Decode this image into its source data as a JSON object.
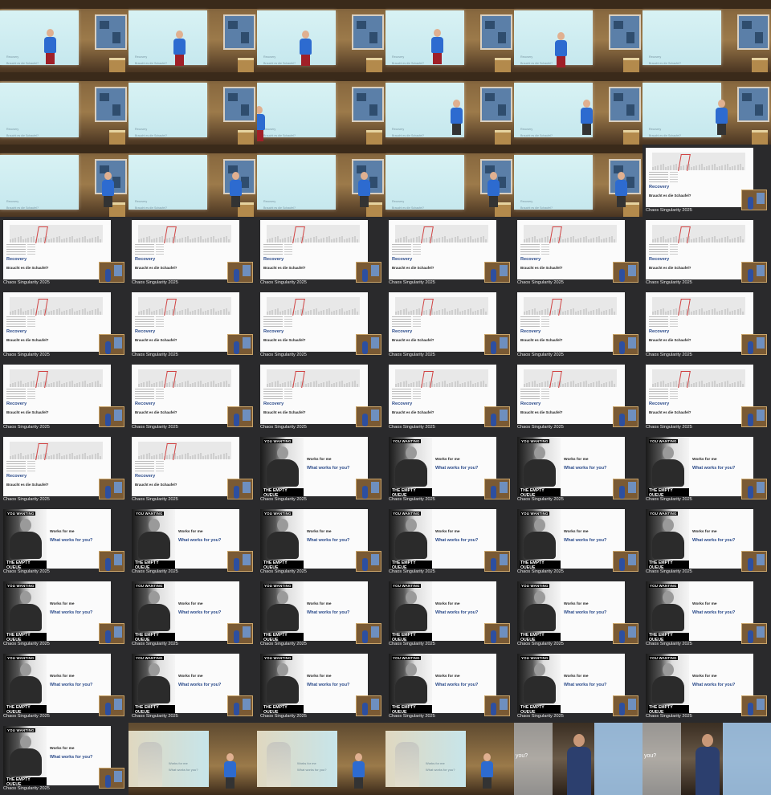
{
  "slides": {
    "recovery": {
      "title": "Recovery",
      "subtitle": "Braucht es die Schaufel?"
    },
    "works": {
      "meme_top": "YOU WANTING",
      "meme_bottom": "THE EMPTY QUEUE",
      "line1": "Works for me",
      "line2": "What works for you?"
    },
    "caption": "Chaos Singularity 2025"
  },
  "room_screen": {
    "line1": "Recovery",
    "line2": "Braucht es die Schaufel?"
  },
  "fade_screen": {
    "line1": "Works for me",
    "line2": "What works for you?"
  },
  "speaker_overlay": "you?",
  "sequence": [
    "room",
    "room",
    "room",
    "room",
    "room",
    "room",
    "room",
    "room",
    "room",
    "room",
    "room",
    "room",
    "room",
    "room",
    "room",
    "room",
    "room",
    "recovery",
    "recovery",
    "recovery",
    "recovery",
    "recovery",
    "recovery",
    "recovery",
    "recovery",
    "recovery",
    "recovery",
    "recovery",
    "recovery",
    "recovery",
    "recovery",
    "recovery",
    "recovery",
    "recovery",
    "recovery",
    "recovery",
    "recovery",
    "recovery",
    "works",
    "works",
    "works",
    "works",
    "works",
    "works",
    "works",
    "works",
    "works",
    "works",
    "works",
    "works",
    "works",
    "works",
    "works",
    "works",
    "works",
    "works",
    "works",
    "works",
    "works",
    "works",
    "works",
    "fade",
    "fade",
    "fade",
    "speaker",
    "speaker"
  ],
  "room_people": [
    {
      "tile": 0,
      "pose": "red"
    },
    {
      "tile": 1,
      "pose": "red"
    },
    {
      "tile": 2,
      "pose": "red"
    },
    {
      "tile": 3,
      "pose": "red"
    },
    {
      "tile": 4,
      "pose": "red"
    },
    {
      "tile": 8,
      "pose": "red"
    },
    {
      "tile": 9,
      "pose": "blue"
    },
    {
      "tile": 10,
      "pose": "blue"
    },
    {
      "tile": 11,
      "pose": "blue"
    },
    {
      "tile": 12,
      "pose": "blue"
    },
    {
      "tile": 13,
      "pose": "blue"
    },
    {
      "tile": 14,
      "pose": "blue"
    },
    {
      "tile": 15,
      "pose": "blue"
    },
    {
      "tile": 16,
      "pose": "blue"
    }
  ]
}
